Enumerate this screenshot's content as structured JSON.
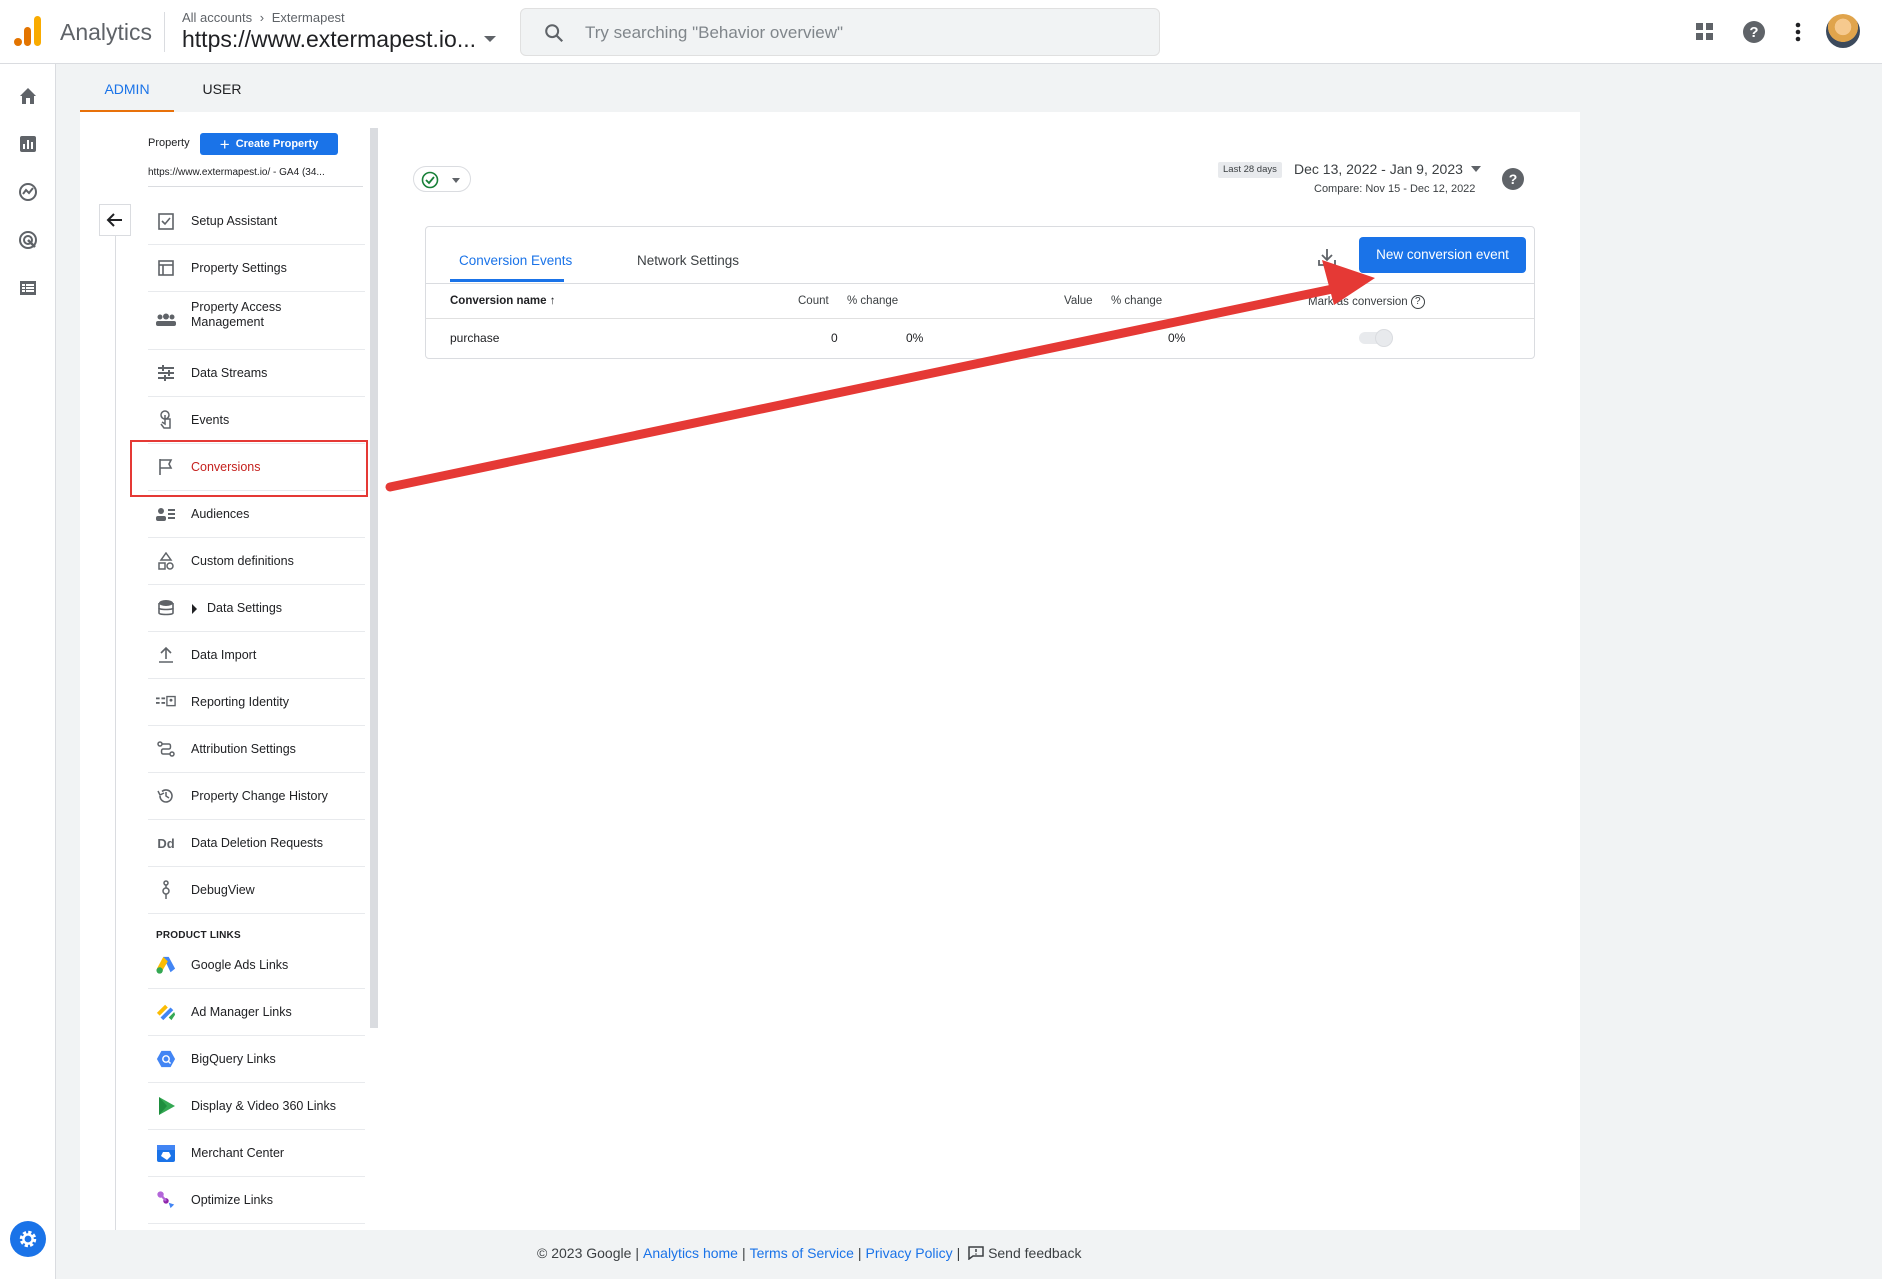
{
  "header": {
    "app_name": "Analytics",
    "breadcrumb_root": "All accounts",
    "breadcrumb_account": "Extermapest",
    "property_title": "https://www.extermapest.io...",
    "search_placeholder": "Try searching \"Behavior overview\""
  },
  "tabs": {
    "admin": "ADMIN",
    "user": "USER"
  },
  "property_panel": {
    "label": "Property",
    "create_label": "Create Property",
    "url": "https://www.extermapest.io/ - GA4 (34..."
  },
  "nav": {
    "setup_assistant": "Setup Assistant",
    "property_settings": "Property Settings",
    "property_access": "Property Access Management",
    "data_streams": "Data Streams",
    "events": "Events",
    "conversions": "Conversions",
    "audiences": "Audiences",
    "custom_definitions": "Custom definitions",
    "data_settings": "Data Settings",
    "data_import": "Data Import",
    "reporting_identity": "Reporting Identity",
    "attribution_settings": "Attribution Settings",
    "property_change_history": "Property Change History",
    "data_deletion_requests": "Data Deletion Requests",
    "debugview": "DebugView",
    "product_links_heading": "PRODUCT LINKS",
    "google_ads_links": "Google Ads Links",
    "ad_manager_links": "Ad Manager Links",
    "bigquery_links": "BigQuery Links",
    "dv360_links": "Display & Video 360 Links",
    "merchant_center": "Merchant Center",
    "optimize_links": "Optimize Links"
  },
  "date": {
    "chip": "Last 28 days",
    "range": "Dec 13, 2022 - Jan 9, 2023",
    "compare": "Compare: Nov 15 - Dec 12, 2022"
  },
  "card": {
    "tab_conversion_events": "Conversion Events",
    "tab_network_settings": "Network Settings",
    "new_button": "New conversion event",
    "columns": {
      "name": "Conversion name",
      "count": "Count",
      "count_change": "% change",
      "value": "Value",
      "value_change": "% change",
      "mark": "Mark as conversion"
    },
    "row": {
      "name": "purchase",
      "count": "0",
      "count_change": "0%",
      "value_change": "0%",
      "marked": false
    }
  },
  "footer": {
    "copyright": "© 2023 Google",
    "analytics_home": "Analytics home",
    "terms": "Terms of Service",
    "privacy": "Privacy Policy",
    "feedback": "Send feedback"
  },
  "colors": {
    "accent": "#1a73e8",
    "active_tab_underline": "#e8710a",
    "highlight_red": "#e53935",
    "logo_orange": "#e37400",
    "logo_yellow": "#f9ab00"
  }
}
